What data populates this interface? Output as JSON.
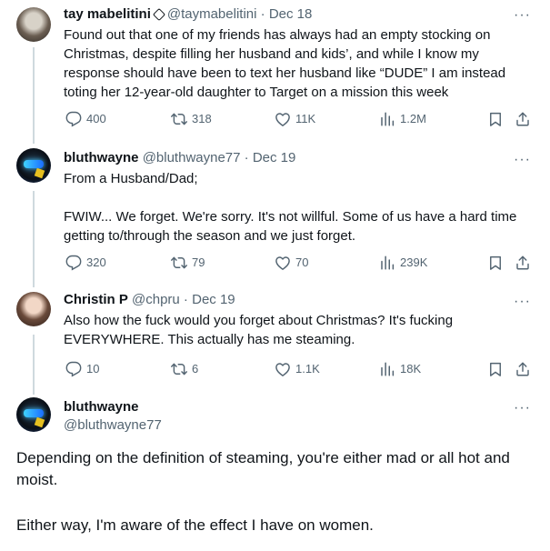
{
  "tweets": [
    {
      "name": "tay mabelitini",
      "handle": "@taymabelitini",
      "date": "Dec 18",
      "more": "···",
      "text": "Found out that one of my friends has always had an empty stocking on Christmas, despite filling her husband and kids’, and while I know my response should have been to text her husband like “DUDE” I am instead toting her 12-year-old daughter to Target on a mission this week",
      "replies": "400",
      "reposts": "318",
      "likes": "11K",
      "views": "1.2M"
    },
    {
      "name": "bluthwayne",
      "handle": "@bluthwayne77",
      "date": "Dec 19",
      "more": "···",
      "text": "From a Husband/Dad;\n\nFWIW... We forget. We're sorry. It's not willful. Some of us have a hard time getting to/through the season and we just forget.",
      "replies": "320",
      "reposts": "79",
      "likes": "70",
      "views": "239K"
    },
    {
      "name": "Christin P",
      "handle": "@chpru",
      "date": "Dec 19",
      "more": "···",
      "text": "Also how the fuck would you forget about Christmas? It's fucking EVERYWHERE. This actually has me steaming.",
      "replies": "10",
      "reposts": "6",
      "likes": "1.1K",
      "views": "18K"
    }
  ],
  "main_tweet": {
    "name": "bluthwayne",
    "handle": "@bluthwayne77",
    "more": "···",
    "text_p1": "Depending on the definition of steaming, you're either mad or all hot and moist.",
    "text_p2": "Either way, I'm aware of the effect I have on women."
  },
  "icons": {
    "reply": "reply-icon",
    "repost": "repost-icon",
    "like": "heart-icon",
    "views": "views-icon",
    "bookmark": "bookmark-icon",
    "share": "share-icon"
  },
  "colors": {
    "text": "#0f1419",
    "muted": "#536471",
    "thread_line": "#cfd9de"
  }
}
